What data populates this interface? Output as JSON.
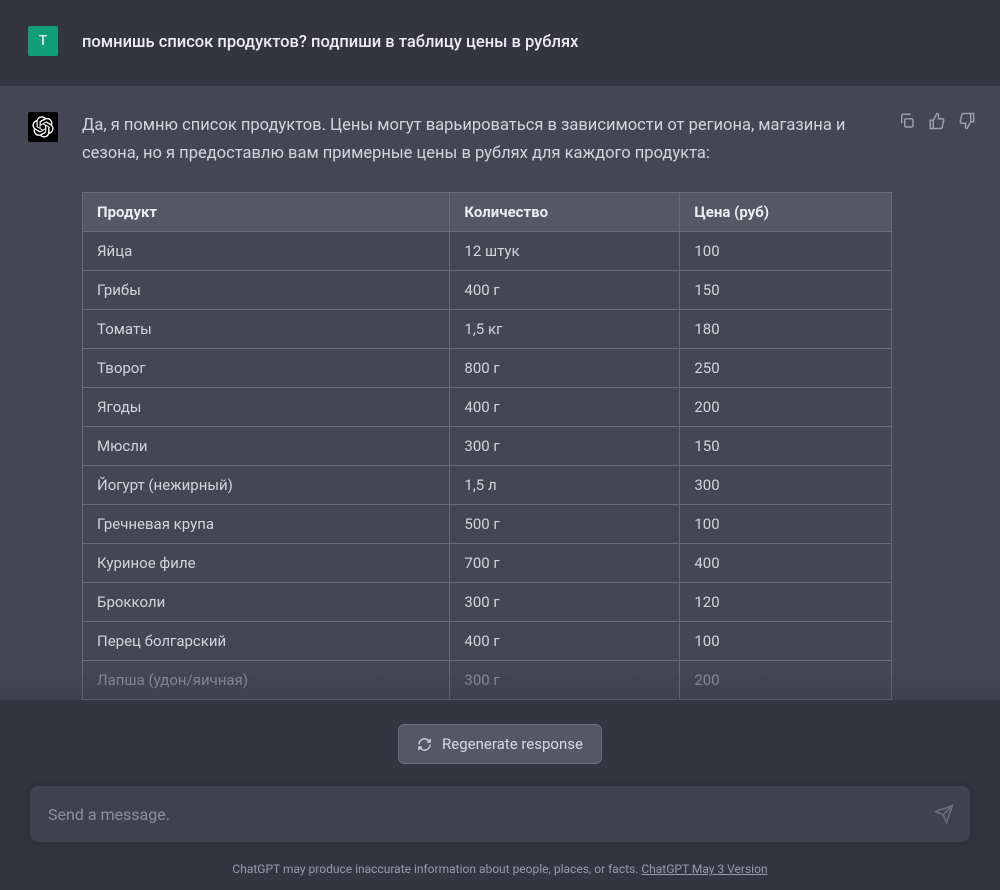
{
  "user": {
    "avatar_initial": "T",
    "message": "помнишь список продуктов? подпиши в таблицу цены в рублях"
  },
  "assistant": {
    "intro": "Да, я помню список продуктов. Цены могут варьироваться в зависимости от региона, магазина и сезона, но я предоставлю вам примерные цены в рублях для каждого продукта:",
    "table": {
      "headers": [
        "Продукт",
        "Количество",
        "Цена (руб)"
      ],
      "rows": [
        [
          "Яйца",
          "12 штук",
          "100"
        ],
        [
          "Грибы",
          "400 г",
          "150"
        ],
        [
          "Томаты",
          "1,5 кг",
          "180"
        ],
        [
          "Творог",
          "800 г",
          "250"
        ],
        [
          "Ягоды",
          "400 г",
          "200"
        ],
        [
          "Мюсли",
          "300 г",
          "150"
        ],
        [
          "Йогурт (нежирный)",
          "1,5 л",
          "300"
        ],
        [
          "Гречневая крупа",
          "500 г",
          "100"
        ],
        [
          "Куриное филе",
          "700 г",
          "400"
        ],
        [
          "Брокколи",
          "300 г",
          "120"
        ],
        [
          "Перец болгарский",
          "400 г",
          "100"
        ],
        [
          "Лапша (удон/яичная)",
          "300 г",
          "200"
        ]
      ]
    }
  },
  "regenerate_label": "Regenerate response",
  "input_placeholder": "Send a message.",
  "footer_text": "ChatGPT may produce inaccurate information about people, places, or facts. ",
  "footer_version": "ChatGPT May 3 Version"
}
